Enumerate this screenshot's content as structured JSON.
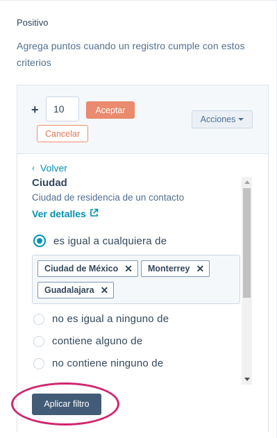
{
  "section": {
    "title": "Positivo",
    "description": "Agrega puntos cuando un registro cumple con estos criterios"
  },
  "editor": {
    "plus_symbol": "+",
    "points_value": "10",
    "accept_label": "Aceptar",
    "cancel_label": "Cancelar",
    "actions_label": "Acciones"
  },
  "filter": {
    "back_label": "Volver",
    "property_name": "Ciudad",
    "property_description": "Ciudad de residencia de un contacto",
    "details_label": "Ver detalles",
    "options": [
      {
        "label": "es igual a cualquiera de",
        "selected": true
      },
      {
        "label": "no es igual a ninguno de",
        "selected": false
      },
      {
        "label": "contiene alguno de",
        "selected": false
      },
      {
        "label": "no contiene ninguno de",
        "selected": false
      }
    ],
    "selected_values": [
      "Ciudad de México",
      "Monterrey",
      "Guadalajara"
    ],
    "remove_symbol": "✕",
    "apply_label": "Aplicar filtro"
  },
  "colors": {
    "accent_link": "#0091ae",
    "primary_button": "#eb8a6e",
    "apply_button": "#425b76",
    "highlight_annotation": "#d1256f"
  }
}
